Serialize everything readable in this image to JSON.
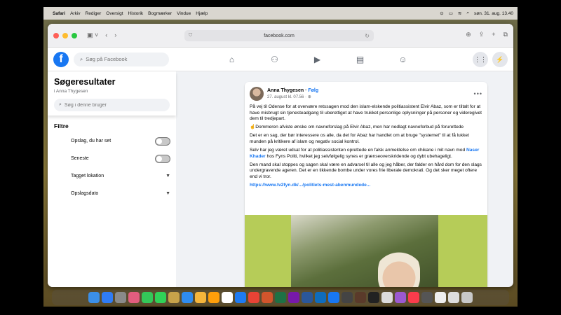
{
  "menubar": {
    "app": "Safari",
    "items": [
      "Arkiv",
      "Rediger",
      "Oversigt",
      "Historik",
      "Bogmærker",
      "Vindue",
      "Hjælp"
    ],
    "clock": "søn. 31. aug.  13.40"
  },
  "browser": {
    "url": "facebook.com"
  },
  "facebook": {
    "search_placeholder": "Søg på Facebook",
    "nav_icons": [
      "home-icon",
      "friends-icon",
      "watch-icon",
      "marketplace-icon",
      "groups-icon"
    ],
    "right_icons": [
      "menu-grid-icon",
      "messenger-icon"
    ]
  },
  "sidebar": {
    "title": "Søgeresultater",
    "subtitle": "i Anna Thygesen",
    "search_placeholder": "Søg i denne bruger",
    "filters_title": "Filtre",
    "filters": [
      {
        "label": "Opslag, du har set",
        "kind": "toggle",
        "on": false
      },
      {
        "label": "Seneste",
        "kind": "toggle",
        "on": false
      },
      {
        "label": "Tagget lokation",
        "kind": "dropdown"
      },
      {
        "label": "Opslagsdato",
        "kind": "dropdown"
      }
    ]
  },
  "post": {
    "author": "Anna Thygesen",
    "follow": "Følg",
    "date": "27. august kl. 07.56",
    "paragraphs": [
      "På vej til Odense for at overvære retssagen mod den islam-elskende politiassistent Elvir Abaz, som er tiltalt for at have misbrugt sin tjenesteadgang til uberettiget at have trukket personlige oplysninger på personer og videregivet dem til tredjepart.",
      "☝️Dommeren afviste ønske om navneforslag på Elvir Abaz, men har nedlagt navneforbud på forurettede",
      "Det er en sag, der bør interessere os alle, da det for Abaz har handlet om at bruge \"systemet\" til at få lukket munden på kritikere af islam og negativ social kontrol."
    ],
    "paragraph4_before": "Selv har jeg været udsat for at politiassistenten oprettede en falsk anmeldelse om chikane i mit navn mod ",
    "mention": "Naser Khader",
    "paragraph4_after": " hos Fyns Politi, hvilket jeg selvfølgelig synes er grænseoverskridende og  dybt ubehageligt.",
    "paragraph5": "Den mand skal stoppes og sagen skal være en advarsel til alle og jeg håber, der falder en hård dom for den slags undergravende ageren. Det er en tikkende bombe under vores frie liberale demokrati. Og det sker meget oftere end vi tror.",
    "link": "https://www.tv2fyn.dk/.../politiets-mest-abenmundede...",
    "image_bg": "#b6cc58"
  },
  "colors": {
    "fb_blue": "#1877f2",
    "page_bg": "#f0f2f5"
  }
}
